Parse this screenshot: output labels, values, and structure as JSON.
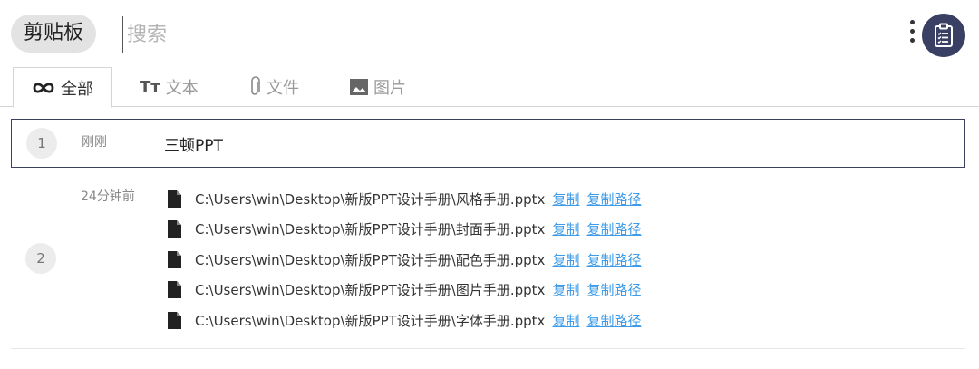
{
  "header": {
    "title": "剪贴板",
    "search_placeholder": "搜索",
    "menu_icon": "kebab-vertical-icon",
    "app_icon": "clipboard-icon",
    "accent_color": "#3a4063"
  },
  "tabs": [
    {
      "label": "全部",
      "icon": "infinity-icon",
      "active": true
    },
    {
      "label": "文本",
      "icon": "text-icon",
      "active": false
    },
    {
      "label": "文件",
      "icon": "paperclip-icon",
      "active": false
    },
    {
      "label": "图片",
      "icon": "image-icon",
      "active": false
    }
  ],
  "items": [
    {
      "index": "1",
      "time": "刚刚",
      "text": "三顿PPT"
    },
    {
      "index": "2",
      "time": "24分钟前",
      "files": [
        {
          "path": "C:\\Users\\win\\Desktop\\新版PPT设计手册\\风格手册.pptx",
          "copy": "复制",
          "copy_path": "复制路径"
        },
        {
          "path": "C:\\Users\\win\\Desktop\\新版PPT设计手册\\封面手册.pptx",
          "copy": "复制",
          "copy_path": "复制路径"
        },
        {
          "path": "C:\\Users\\win\\Desktop\\新版PPT设计手册\\配色手册.pptx",
          "copy": "复制",
          "copy_path": "复制路径"
        },
        {
          "path": "C:\\Users\\win\\Desktop\\新版PPT设计手册\\图片手册.pptx",
          "copy": "复制",
          "copy_path": "复制路径"
        },
        {
          "path": "C:\\Users\\win\\Desktop\\新版PPT设计手册\\字体手册.pptx",
          "copy": "复制",
          "copy_path": "复制路径"
        }
      ]
    }
  ]
}
